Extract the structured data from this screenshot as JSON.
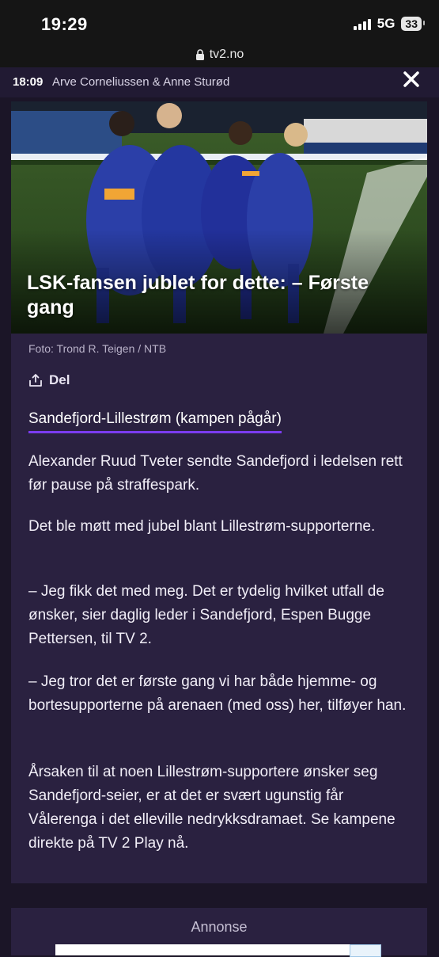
{
  "status_bar": {
    "time": "19:29",
    "network": "5G",
    "battery": "33"
  },
  "browser": {
    "url": "tv2.no"
  },
  "meta": {
    "time": "18:09",
    "authors": "Arve Corneliussen & Anne Sturød"
  },
  "article": {
    "title": "LSK-fansen jublet for dette: – Første gang",
    "photo_credit": "Foto: Trond R. Teigen / NTB",
    "share_label": "Del",
    "match_link": "Sandefjord-Lillestrøm (kampen pågår)",
    "paragraphs": [
      "Alexander Ruud Tveter sendte Sandefjord i ledelsen rett før pause på straffespark.",
      "Det ble møtt med jubel blant Lillestrøm-supporterne.",
      "– Jeg fikk det med meg. Det er tydelig hvilket utfall de ønsker, sier daglig leder i Sandefjord, Espen Bugge Pettersen, til TV 2.",
      "– Jeg tror det er første gang vi har både hjemme- og bortesupporterne på arenaen (med oss) her, tilføyer han.",
      "Årsaken til at noen Lillestrøm-supportere ønsker seg Sandefjord-seier, er at det er svært ugunstig får Vålerenga i det elleville nedrykksdramaet. Se kampene direkte på TV 2 Play nå."
    ]
  },
  "ad": {
    "label": "Annonse"
  },
  "colors": {
    "accent": "#7b3cf0",
    "background": "#1b1527",
    "card": "#2a2140"
  }
}
